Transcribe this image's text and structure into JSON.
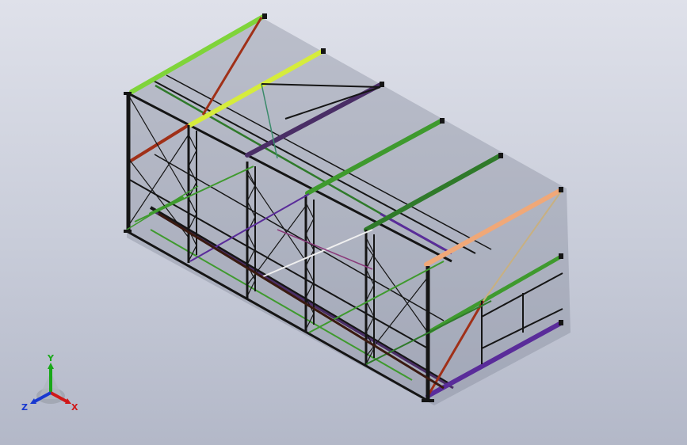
{
  "triad": {
    "x_label": "X",
    "y_label": "Y",
    "z_label": "Z",
    "x_color": "#d01818",
    "y_color": "#18a818",
    "z_color": "#1838d0"
  },
  "colors": {
    "background_top": "#dfe1ea",
    "background_bottom": "#b3b8c8",
    "frame_dark": "#151515",
    "beam_bright_green": "#7fd43a",
    "beam_yellow_green": "#d6ec3c",
    "beam_purple": "#4a2e66",
    "beam_green": "#3f9a2e",
    "beam_dark_green": "#2f7a2a",
    "beam_peach": "#f0a878",
    "beam_violet": "#5a2c9a",
    "brace_red": "#a03018",
    "shadow": "#7c8192"
  }
}
